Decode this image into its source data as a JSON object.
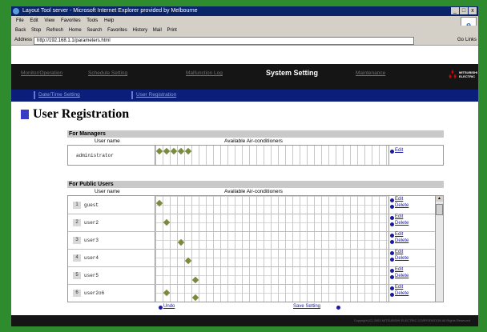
{
  "browser": {
    "title": "Layout Tool server - Microsoft Internet Explorer provided by Melbourne",
    "window_buttons": [
      "_",
      "□",
      "x"
    ],
    "menu": [
      "File",
      "Edit",
      "View",
      "Favorites",
      "Tools",
      "Help"
    ],
    "toolbar": [
      "Back",
      "Stop",
      "Refresh",
      "Home",
      "Search",
      "Favorites",
      "History",
      "Mail",
      "Print"
    ],
    "address_label": "Address",
    "address_value": "http://192.168.1.1/parameters.html",
    "go_label": "Go",
    "links_label": "Links"
  },
  "nav": {
    "items": [
      {
        "label": "Monitor/Operation",
        "active": false
      },
      {
        "label": "Schedule Setting",
        "active": false
      },
      {
        "label": "Malfunction Log",
        "active": false
      },
      {
        "label": "System Setting",
        "active": true
      },
      {
        "label": "Maintenance",
        "active": false
      }
    ],
    "brand": "MITSUBISHI ELECTRIC"
  },
  "subnav": {
    "items": [
      "Date/Time Setting",
      "User Registration"
    ]
  },
  "page": {
    "title": "User Registration"
  },
  "managers": {
    "heading": "For Managers",
    "col_user": "User name",
    "col_ac": "Available Air-conditioners",
    "rows": [
      {
        "name": "administrator",
        "selected_cols": [
          0,
          1,
          2,
          3,
          4
        ],
        "edit": "Edit"
      }
    ]
  },
  "public": {
    "heading": "For Public Users",
    "col_user": "User name",
    "col_ac": "Available Air-conditioners",
    "rows": [
      {
        "num": "1",
        "name": "guest",
        "selected_cols": [
          0
        ],
        "edit": "Edit",
        "delete": "Delete"
      },
      {
        "num": "2",
        "name": "user2",
        "selected_cols": [
          1
        ],
        "edit": "Edit",
        "delete": "Delete"
      },
      {
        "num": "3",
        "name": "user3",
        "selected_cols": [
          3
        ],
        "edit": "Edit",
        "delete": "Delete"
      },
      {
        "num": "4",
        "name": "user4",
        "selected_cols": [
          4
        ],
        "edit": "Edit",
        "delete": "Delete"
      },
      {
        "num": "5",
        "name": "user5",
        "selected_cols": [
          5
        ],
        "edit": "Edit",
        "delete": "Delete"
      },
      {
        "num": "6",
        "name": "user2o6",
        "selected_cols": [
          1,
          5
        ],
        "edit": "Edit",
        "delete": "Delete"
      }
    ]
  },
  "actions": {
    "undo": "Undo",
    "save": "Save Setting"
  },
  "footer": {
    "copyright": "Copyright (C) 2003 MITSUBISHI ELECTRIC CORPORATION All Rights Reserved"
  },
  "colors": {
    "accent_green": "#2e8b2e",
    "nav_bg": "#151515",
    "subnav_bg": "#0b1e7a",
    "dot": "#7a8a3e",
    "link": "#1a1aa0"
  }
}
